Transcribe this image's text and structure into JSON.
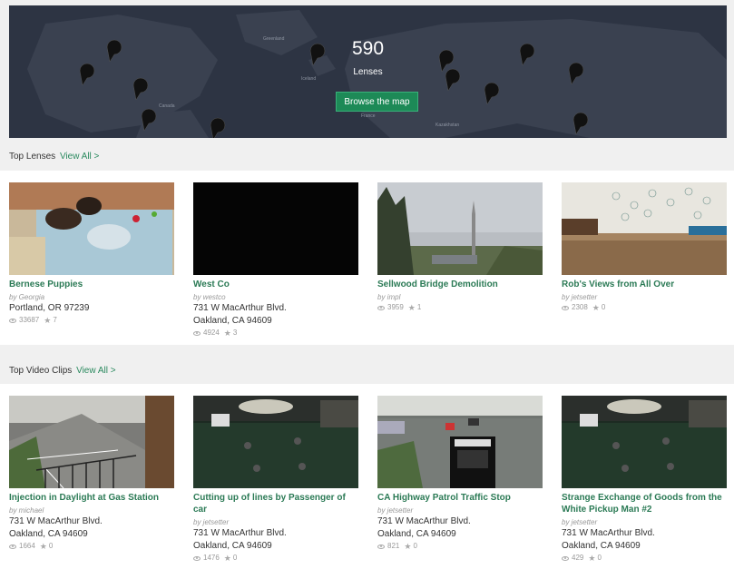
{
  "hero": {
    "count": "590",
    "label": "Lenses",
    "button": "Browse the map",
    "map_labels": [
      "Greenland",
      "Iceland",
      "Canada",
      "France",
      "Kazakhstan"
    ]
  },
  "top_lenses": {
    "heading": "Top Lenses",
    "view_all": "View All >",
    "items": [
      {
        "title": "Bernese Puppies",
        "by": "by Georgia",
        "addr1": "Portland, OR 97239",
        "addr2": "",
        "views": "33687",
        "stars": "7"
      },
      {
        "title": "West Co",
        "by": "by westco",
        "addr1": "731 W MacArthur Blvd.",
        "addr2": "Oakland, CA 94609",
        "views": "4924",
        "stars": "3"
      },
      {
        "title": "Sellwood Bridge Demolition",
        "by": "by impl",
        "addr1": "",
        "addr2": "",
        "views": "3959",
        "stars": "1"
      },
      {
        "title": "Rob's Views from All Over",
        "by": "by jetsetter",
        "addr1": "",
        "addr2": "",
        "views": "2308",
        "stars": "0"
      }
    ]
  },
  "top_clips": {
    "heading": "Top Video Clips",
    "view_all": "View All >",
    "items": [
      {
        "title": "Injection in Daylight at Gas Station",
        "by": "by michael",
        "addr1": "731 W MacArthur Blvd.",
        "addr2": "Oakland, CA 94609",
        "views": "1664",
        "stars": "0"
      },
      {
        "title": "Cutting up of lines by Passenger of car",
        "by": "by jetsetter",
        "addr1": "731 W MacArthur Blvd.",
        "addr2": "Oakland, CA 94609",
        "views": "1476",
        "stars": "0"
      },
      {
        "title": "CA Highway Patrol Traffic Stop",
        "by": "by jetsetter",
        "addr1": "731 W MacArthur Blvd.",
        "addr2": "Oakland, CA 94609",
        "views": "821",
        "stars": "0"
      },
      {
        "title": "Strange Exchange of Goods from the White Pickup Man #2",
        "by": "by jetsetter",
        "addr1": "731 W MacArthur Blvd.",
        "addr2": "Oakland, CA 94609",
        "views": "429",
        "stars": "0"
      }
    ]
  }
}
